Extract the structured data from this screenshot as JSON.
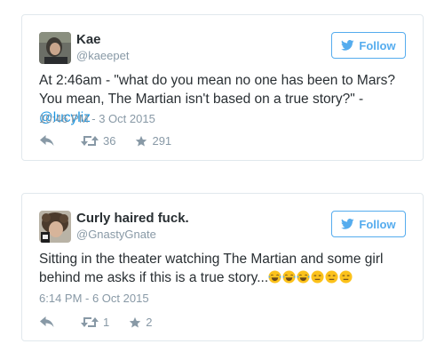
{
  "tweets": [
    {
      "name": "Kae",
      "handle": "@kaeepet",
      "follow_label": "Follow",
      "text": "At 2:46am - \"what do you mean no one has been to Mars? You mean, The Martian isn't based on a true story?\" -",
      "mention": "@lucyliz",
      "timestamp": "10:46 PM - 3 Oct 2015",
      "retweets": "36",
      "likes": "291"
    },
    {
      "name": "Curly haired fuck.",
      "handle": "@GnastyGnate",
      "follow_label": "Follow",
      "text": "Sitting in the theater watching The Martian and some girl behind me asks if this is a true story...",
      "emojis": [
        "face-with-tears-of-joy",
        "face-with-tears-of-joy",
        "face-with-tears-of-joy",
        "expressionless-face",
        "expressionless-face",
        "expressionless-face"
      ],
      "timestamp": "6:14 PM - 6 Oct 2015",
      "retweets": "1",
      "likes": "2"
    }
  ],
  "colors": {
    "accent": "#55acee",
    "link": "#1b95e0",
    "muted": "#8899a6",
    "text": "#292f33",
    "border": "#e1e8ed"
  },
  "icons": {
    "follow": "twitter-bird-icon",
    "reply": "reply-arrow-icon",
    "retweet": "retweet-icon",
    "like": "star-icon"
  }
}
